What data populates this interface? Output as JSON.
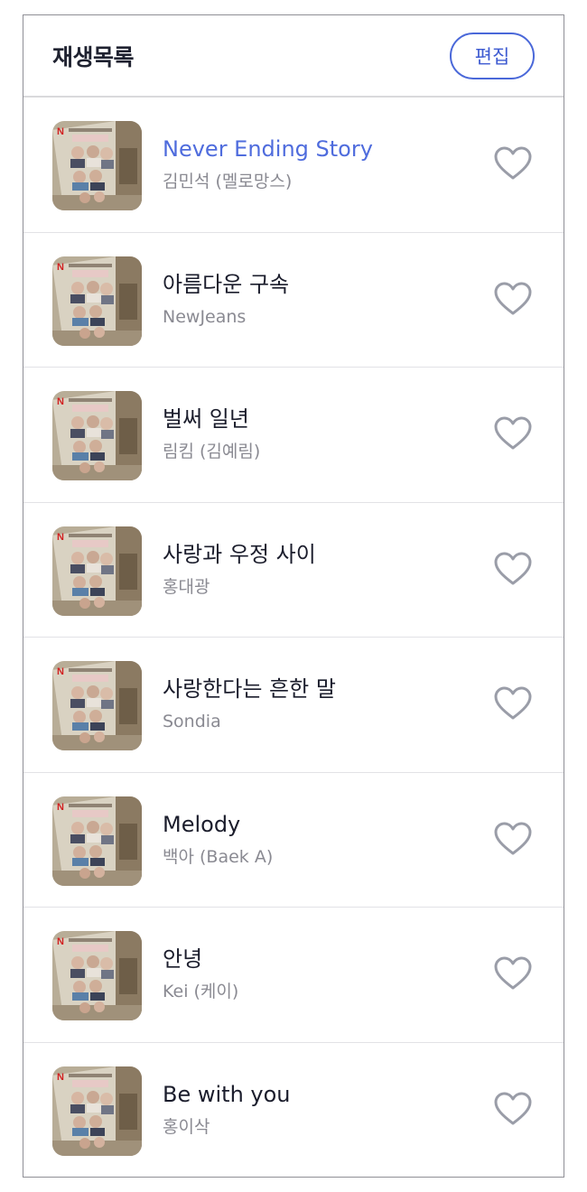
{
  "header": {
    "title": "재생목록",
    "edit_label": "편집"
  },
  "colors": {
    "accent": "#4f6cdd",
    "text": "#1b1d2c",
    "subtext": "#8a8a92",
    "heart": "#9a9da8"
  },
  "playlist": [
    {
      "song": "Never Ending Story",
      "artist": "김민석 (멜로망스)",
      "active": true
    },
    {
      "song": "아름다운 구속",
      "artist": "NewJeans",
      "active": false
    },
    {
      "song": "벌써 일년",
      "artist": "림킴 (김예림)",
      "active": false
    },
    {
      "song": "사랑과 우정 사이",
      "artist": "홍대광",
      "active": false
    },
    {
      "song": "사랑한다는 흔한 말",
      "artist": "Sondia",
      "active": false
    },
    {
      "song": "Melody",
      "artist": "백아 (Baek A)",
      "active": false
    },
    {
      "song": "안녕",
      "artist": "Kei (케이)",
      "active": false
    },
    {
      "song": "Be with you",
      "artist": "홍이삭",
      "active": false
    }
  ]
}
